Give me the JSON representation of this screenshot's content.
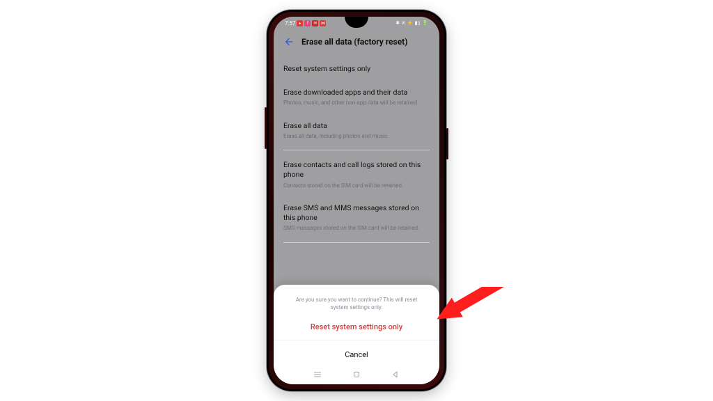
{
  "status": {
    "time": "7:57",
    "right_glyphs": "✱ ⊘ ⚡ ▮▯ 🔋"
  },
  "header": {
    "title": "Erase all data (factory reset)"
  },
  "options": [
    {
      "label": "Reset system settings only",
      "sub": null
    },
    {
      "label": "Erase downloaded apps and their data",
      "sub": "Photos, music, and other non-app data will be retained."
    },
    {
      "label": "Erase all data",
      "sub": "Erase all data, including photos and music."
    },
    {
      "label": "Erase contacts and call logs stored on this phone",
      "sub": "Contacts stored on the SIM card will be retained."
    },
    {
      "label": "Erase SMS and MMS messages stored on this phone",
      "sub": "SMS messages stored on the SIM card will be retained."
    }
  ],
  "sheet": {
    "message": "Are you sure you want to continue? This will reset system settings only.",
    "primary": "Reset system settings only",
    "cancel": "Cancel"
  }
}
